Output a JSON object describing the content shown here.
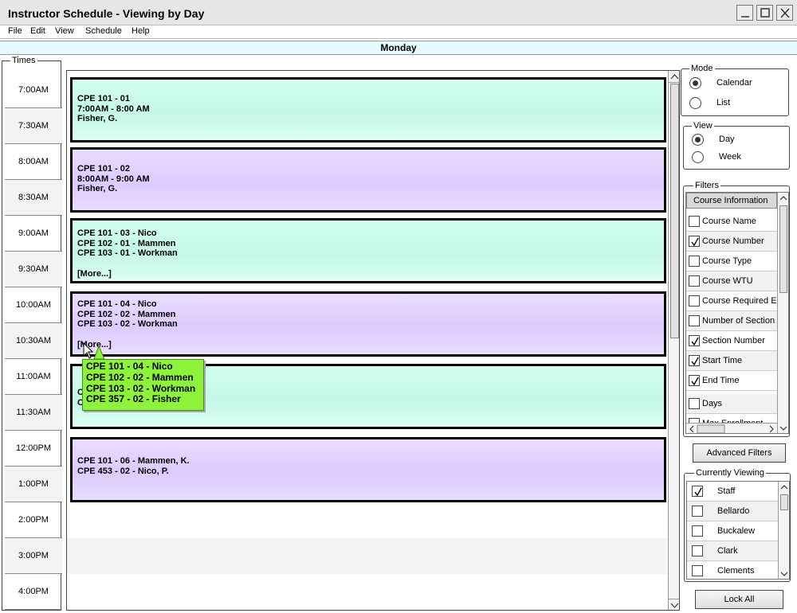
{
  "window": {
    "title": "Instructor Schedule - Viewing by Day"
  },
  "menu": [
    "File",
    "Edit",
    "View",
    "Schedule",
    "Help"
  ],
  "day_header": "Monday",
  "times": {
    "legend": "Times",
    "slots": [
      "7:00AM",
      "7:30AM",
      "8:00AM",
      "8:30AM",
      "9:00AM",
      "9:30AM",
      "10:00AM",
      "10:30AM",
      "11:00AM",
      "11:30AM",
      "12:00PM",
      "1:00PM",
      "2:00PM",
      "3:00PM",
      "4:00PM"
    ]
  },
  "events": [
    {
      "color": "green",
      "lines": [
        "CPE 101 - 01",
        "7:00AM - 8:00 AM",
        "Fisher, G."
      ]
    },
    {
      "color": "purple",
      "lines": [
        "CPE 101 - 02",
        "8:00AM - 9:00 AM",
        "Fisher, G."
      ]
    },
    {
      "color": "green",
      "lines": [
        "CPE 101 - 03 - Nico",
        "CPE 102 - 01 - Mammen",
        "CPE 103 - 01 - Workman"
      ],
      "more": "[More...]"
    },
    {
      "color": "purple",
      "lines": [
        "CPE 101 - 04 - Nico",
        "CPE 102 - 02 - Mammen",
        "CPE 103 - 02 - Workman"
      ],
      "more": "[More...]"
    },
    {
      "color": "green",
      "lines": [
        "C",
        "C"
      ]
    },
    {
      "color": "purple",
      "lines": [
        "CPE 101 - 06 - Mammen, K.",
        "CPE 453 - 02 - Nico, P."
      ]
    }
  ],
  "tooltip": [
    "CPE 101 - 04 - Nico",
    "CPE 102 - 02 - Mammen",
    "CPE 103 - 02 - Workman",
    "CPE 357 - 02 - Fisher"
  ],
  "mode": {
    "legend": "Mode",
    "options": [
      "Calendar",
      "List"
    ],
    "selected": "Calendar"
  },
  "view": {
    "legend": "View",
    "options": [
      "Day",
      "Week"
    ],
    "selected": "Day"
  },
  "filters": {
    "legend": "Filters",
    "header": "Course Information",
    "items": [
      {
        "label": "Course Name",
        "checked": false
      },
      {
        "label": "Course Number",
        "checked": true
      },
      {
        "label": "Course Type",
        "checked": false
      },
      {
        "label": "Course WTU",
        "checked": false
      },
      {
        "label": "Course Required E",
        "checked": false
      },
      {
        "label": "Number of Section",
        "checked": false
      },
      {
        "label": "Section Number",
        "checked": true
      },
      {
        "label": "Start Time",
        "checked": true
      },
      {
        "label": "End Time",
        "checked": true
      },
      {
        "label": "Days",
        "checked": false
      },
      {
        "label": "Max Enrollment",
        "checked": false
      }
    ]
  },
  "advanced_filters_label": "Advanced Filters",
  "currently_viewing": {
    "legend": "Currently Viewing",
    "items": [
      {
        "label": "Staff",
        "checked": true
      },
      {
        "label": "Bellardo",
        "checked": false
      },
      {
        "label": "Buckalew",
        "checked": false
      },
      {
        "label": "Clark",
        "checked": false
      },
      {
        "label": "Clements",
        "checked": false
      }
    ]
  },
  "lock_all_label": "Lock All"
}
